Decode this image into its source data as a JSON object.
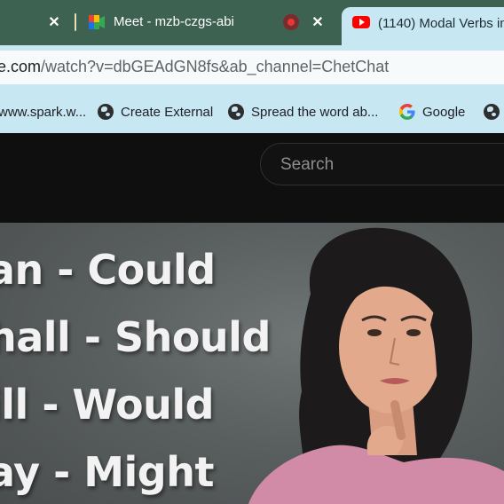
{
  "browser": {
    "tabs": [
      {
        "label": "",
        "active": false
      },
      {
        "label": "Meet - mzb-czgs-abi",
        "icon": "google-meet-icon",
        "active": false
      },
      {
        "label": "(1140) Modal Verbs in",
        "icon": "youtube-icon",
        "active": true
      }
    ],
    "url_host": "e.com",
    "url_path": "/watch?v=dbGEAdGN8fs&ab_channel=ChetChat",
    "bookmarks": [
      {
        "label": "www.spark.w...",
        "icon": "none"
      },
      {
        "label": "Create External",
        "icon": "globe-icon"
      },
      {
        "label": "Spread the word ab...",
        "icon": "globe-icon"
      },
      {
        "label": "Google",
        "icon": "google-icon"
      },
      {
        "label": "",
        "icon": "globe-icon"
      }
    ]
  },
  "youtube": {
    "search_placeholder": "Search"
  },
  "video": {
    "lines": [
      "an - Could",
      "hall - Should",
      "ill - Would",
      "ay - Might"
    ]
  },
  "colors": {
    "tabstrip": "#3d6252",
    "toolbar": "#c7e7f3",
    "youtube_bg": "#0f0f0f",
    "youtube_red": "#ff0000"
  }
}
